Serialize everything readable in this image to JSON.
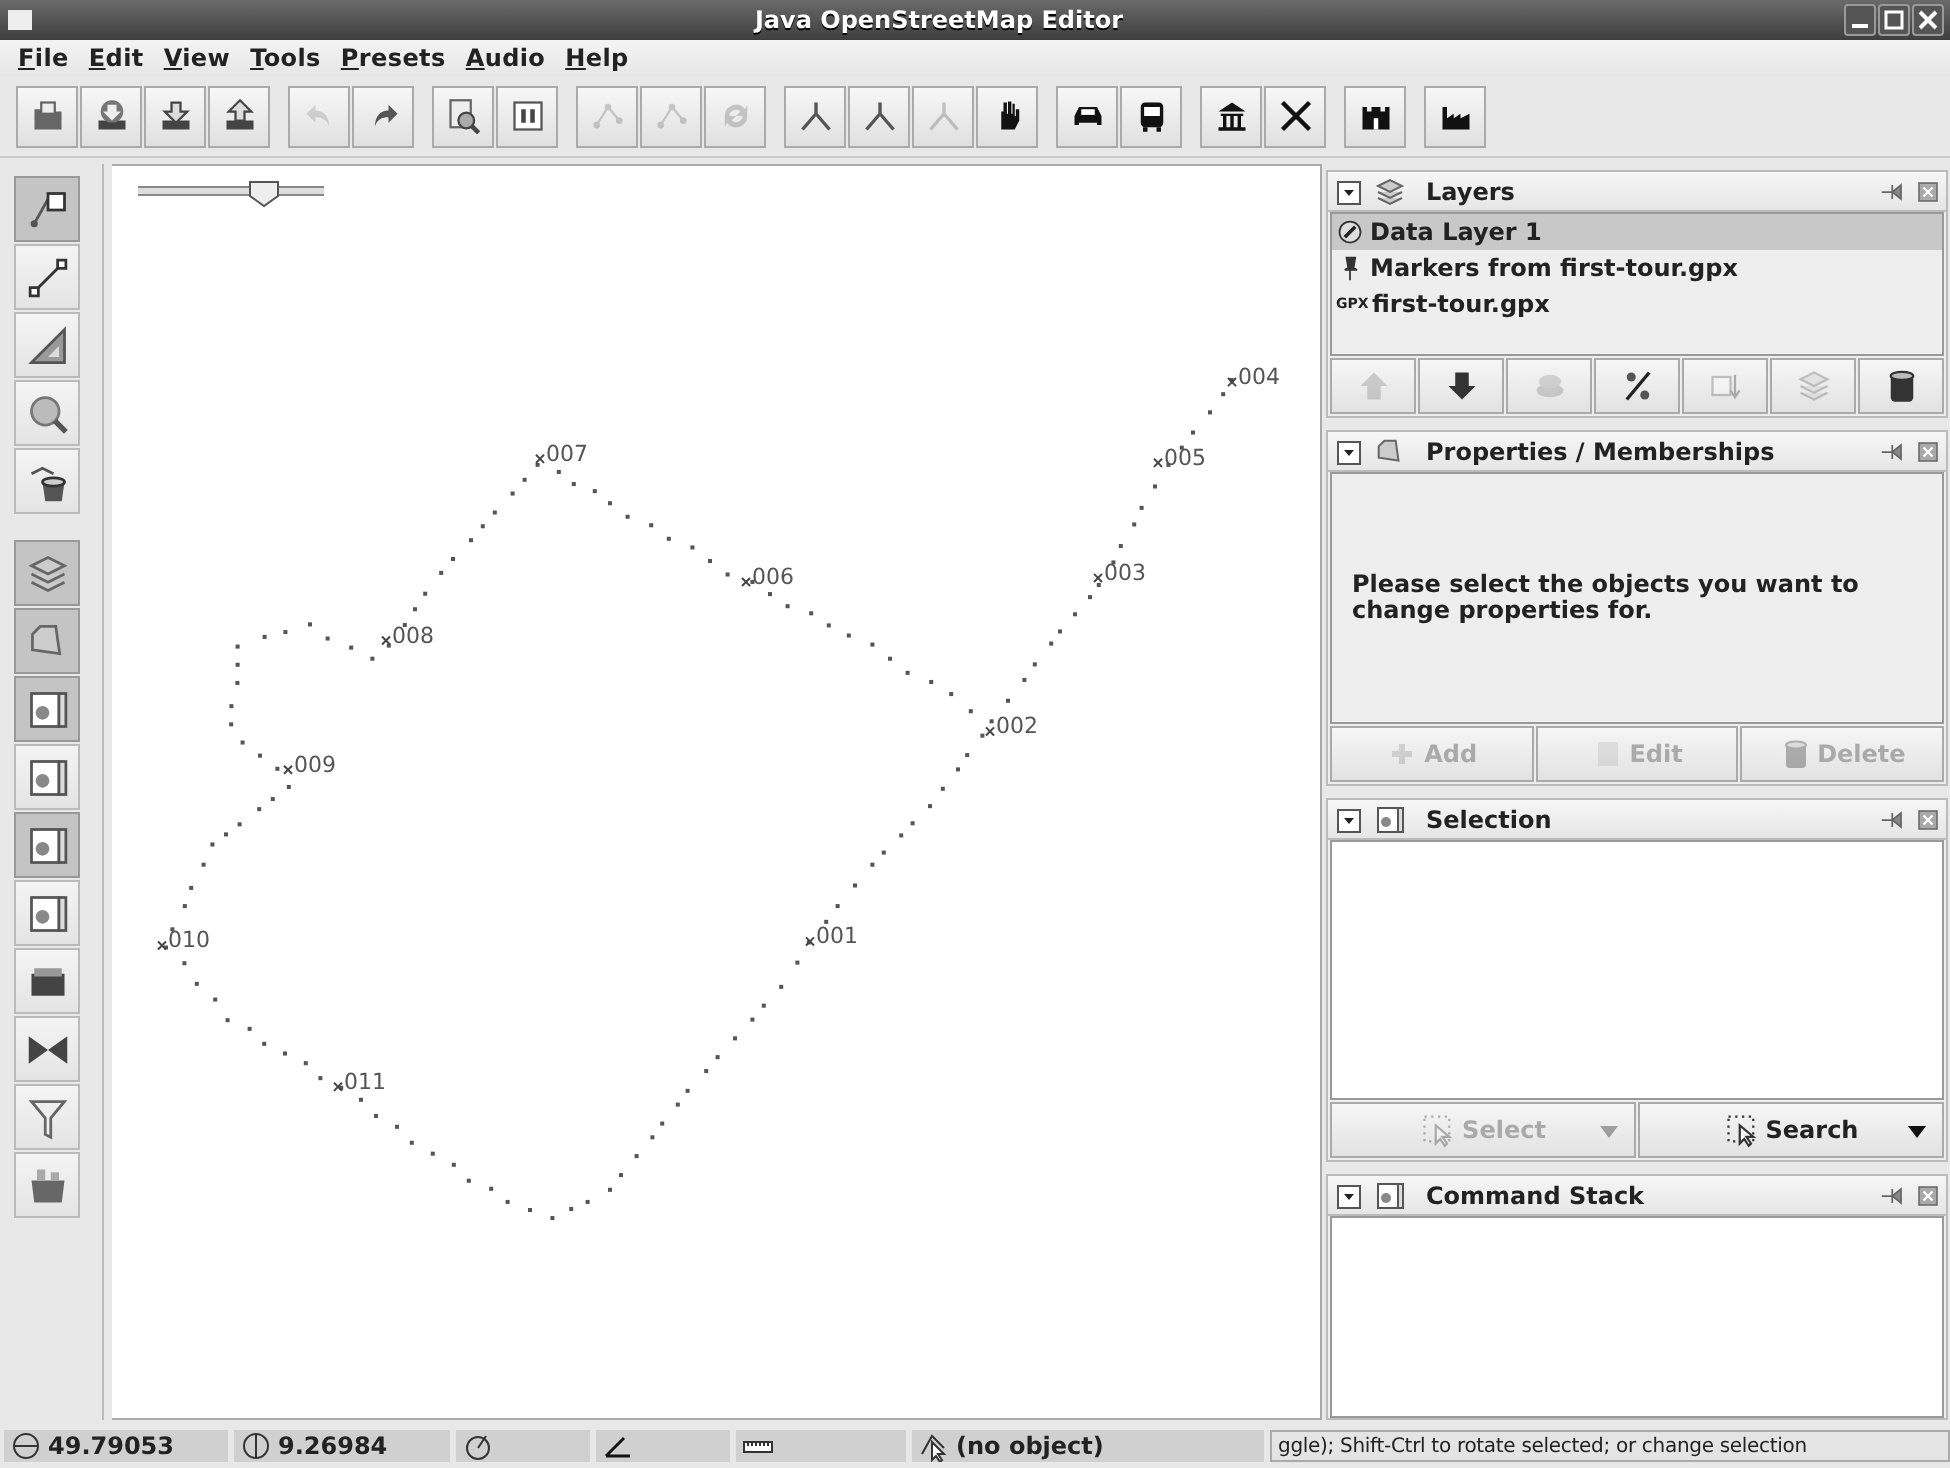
{
  "window": {
    "title": "Java OpenStreetMap Editor"
  },
  "menu": [
    "File",
    "Edit",
    "View",
    "Tools",
    "Presets",
    "Audio",
    "Help"
  ],
  "toolbar": [
    [
      {
        "disabled": false
      },
      {
        "disabled": false
      },
      {
        "disabled": false
      },
      {
        "disabled": false
      }
    ],
    [
      {
        "disabled": true
      },
      {
        "disabled": false
      }
    ],
    [
      {
        "disabled": false
      },
      {
        "disabled": false
      }
    ],
    [
      {
        "disabled": true
      },
      {
        "disabled": true
      },
      {
        "disabled": true
      }
    ],
    [
      {
        "disabled": false
      },
      {
        "disabled": false
      },
      {
        "disabled": true
      },
      {
        "disabled": false
      }
    ],
    [
      {
        "disabled": false
      },
      {
        "disabled": false
      }
    ],
    [
      {
        "disabled": false
      },
      {
        "disabled": false
      }
    ],
    [
      {
        "disabled": false
      }
    ],
    [
      {
        "disabled": false
      }
    ]
  ],
  "side_toolbar": [
    [
      {
        "selected": true
      },
      {
        "selected": false
      },
      {
        "selected": false
      },
      {
        "selected": false
      },
      {
        "selected": false
      }
    ],
    [
      {
        "selected": true
      },
      {
        "selected": true
      },
      {
        "selected": true
      },
      {
        "selected": false
      },
      {
        "selected": true
      },
      {
        "selected": false
      },
      {
        "selected": false
      },
      {
        "selected": false
      },
      {
        "selected": false
      },
      {
        "selected": false
      }
    ]
  ],
  "map": {
    "zoom_slider": {
      "level": 0.68
    },
    "waypoints": [
      {
        "label": "001"
      },
      {
        "label": "002"
      },
      {
        "label": "003"
      },
      {
        "label": "004"
      },
      {
        "label": "005"
      },
      {
        "label": "006"
      },
      {
        "label": "007"
      },
      {
        "label": "008"
      },
      {
        "label": "009"
      },
      {
        "label": "010"
      },
      {
        "label": "011"
      }
    ]
  },
  "layers": {
    "title": "Layers",
    "items": [
      {
        "kind": "data",
        "name": "Data Layer 1",
        "selected": true
      },
      {
        "kind": "markers",
        "name": "Markers from first-tour.gpx",
        "selected": false
      },
      {
        "kind": "gpx",
        "badge": "GPX",
        "name": "first-tour.gpx",
        "selected": false
      }
    ],
    "buttons": [
      {
        "disabled": true
      },
      {
        "disabled": false
      },
      {
        "disabled": true
      },
      {
        "disabled": false
      },
      {
        "disabled": true
      },
      {
        "disabled": true
      },
      {
        "disabled": false
      }
    ]
  },
  "properties": {
    "title": "Properties / Memberships",
    "message": "Please select the objects you want to change properties for.",
    "buttons": [
      {
        "label": "Add",
        "disabled": true
      },
      {
        "label": "Edit",
        "disabled": true
      },
      {
        "label": "Delete",
        "disabled": true
      }
    ]
  },
  "selection": {
    "title": "Selection",
    "buttons": [
      {
        "label": "Select",
        "disabled": true
      },
      {
        "label": "Search",
        "disabled": false
      }
    ]
  },
  "command_stack": {
    "title": "Command Stack"
  },
  "status_bar": [
    {
      "kind": "lat",
      "text": "49.79053"
    },
    {
      "kind": "lon",
      "text": "9.26984"
    },
    {
      "kind": "heading"
    },
    {
      "kind": "angle"
    },
    {
      "kind": "distance"
    },
    {
      "kind": "object",
      "text": "(no object)"
    },
    {
      "kind": "help",
      "text": "ggle); Shift-Ctrl to rotate selected; or change selection"
    }
  ]
}
